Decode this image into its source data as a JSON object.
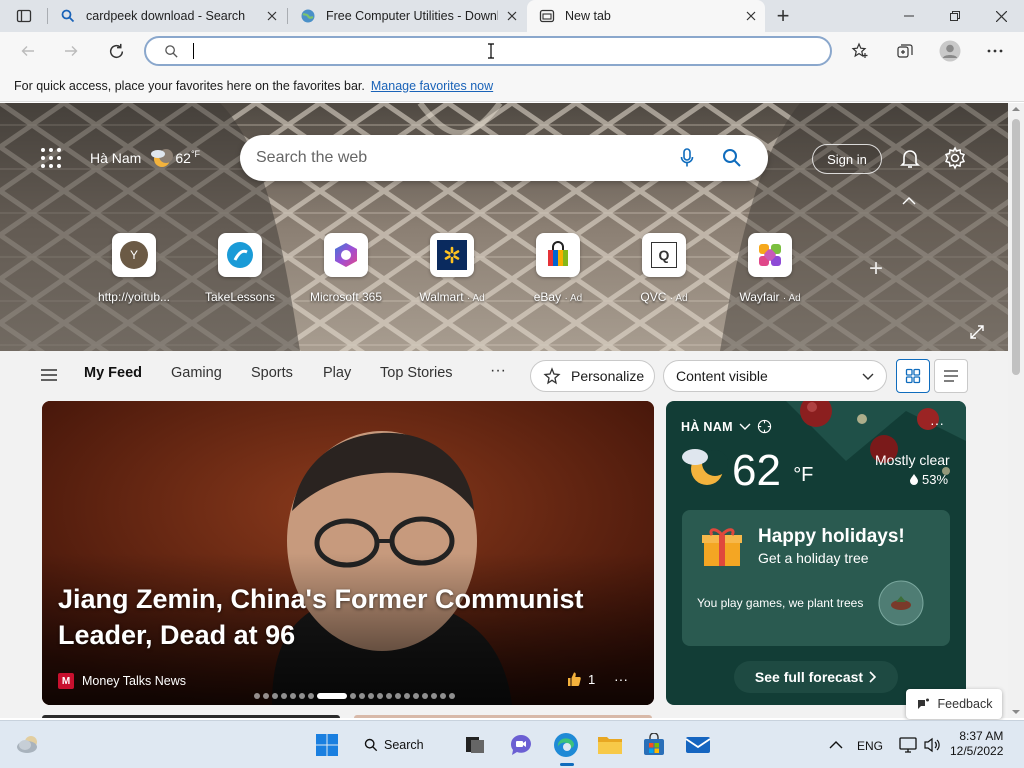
{
  "browser": {
    "tabs": [
      {
        "title": "cardpeek download - Search",
        "favicon": "search-icon"
      },
      {
        "title": "Free Computer Utilities - Downlo",
        "favicon": "site-globe-icon"
      },
      {
        "title": "New tab",
        "favicon": "new-tab-page-icon",
        "active": true
      }
    ],
    "new_tab_symbol": "+",
    "address": {
      "value": ""
    },
    "favorites_bar": {
      "message": "For quick access, place your favorites here on the favorites bar.",
      "link": "Manage favorites now"
    }
  },
  "newtab": {
    "location": "Hà Nam",
    "temp": "62",
    "unit": "°F",
    "search_placeholder": "Search the web",
    "sign_in": "Sign in",
    "quick_links": [
      {
        "label": "http://yoitub...",
        "ad": "",
        "icon": "letter-y-avatar",
        "letter": "Y"
      },
      {
        "label": "TakeLessons",
        "ad": "",
        "icon": "takelessons-icon"
      },
      {
        "label": "Microsoft 365",
        "ad": "",
        "icon": "microsoft-365-icon"
      },
      {
        "label": "Walmart",
        "ad": "· Ad",
        "icon": "walmart-icon"
      },
      {
        "label": "eBay",
        "ad": "· Ad",
        "icon": "ebay-icon"
      },
      {
        "label": "QVC",
        "ad": "· Ad",
        "icon": "qvc-icon",
        "letter": "Q"
      },
      {
        "label": "Wayfair",
        "ad": "· Ad",
        "icon": "wayfair-icon"
      }
    ],
    "add_symbol": "+",
    "nav": {
      "items": [
        "My Feed",
        "Gaming",
        "Sports",
        "Play",
        "Top Stories"
      ],
      "more": "···",
      "personalize": "Personalize",
      "content": "Content visible"
    },
    "headline": {
      "title": "Jiang Zemin, China's Former Communist Leader, Dead at 96",
      "source": "Money Talks News",
      "source_logo": "M",
      "likes": "1",
      "more": "···",
      "dots_total": 20,
      "dots_active": 7
    },
    "weather": {
      "location": "HÀ NAM",
      "temp": "62",
      "unit": "°F",
      "condition": "Mostly clear",
      "humidity": "53%",
      "more": "···",
      "promo_title": "Happy holidays!",
      "promo_sub": "Get a holiday tree",
      "promo_text": "You play games, we plant trees",
      "forecast": "See full forecast"
    },
    "feedback": "Feedback"
  },
  "taskbar": {
    "search": "Search",
    "lang": "ENG",
    "time": "8:37 AM",
    "date": "12/5/2022"
  },
  "colors": {
    "accent": "#0f6cbd",
    "link": "#1a63b8",
    "weather_bg": "#123d36"
  }
}
